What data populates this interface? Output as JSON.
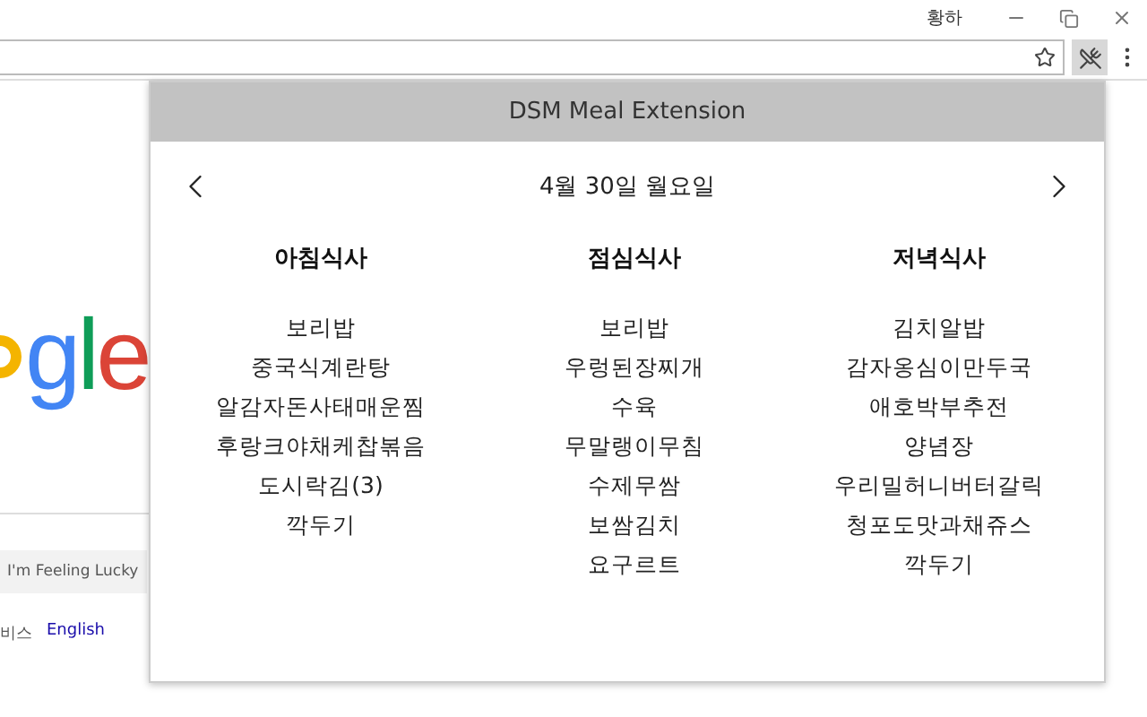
{
  "window": {
    "user": "황하"
  },
  "page": {
    "logo": [
      {
        "text": "g",
        "color": "#4285f4"
      },
      {
        "text": "l",
        "color": "#0f9d58"
      },
      {
        "text": "e",
        "color": "#db4437"
      }
    ],
    "lucky_button": "I'm Feeling Lucky",
    "footer_text": "비스",
    "footer_link": "English"
  },
  "popup": {
    "title": "DSM Meal Extension",
    "date": "4월 30일 월요일",
    "meals": [
      {
        "name": "아침식사",
        "items": [
          "보리밥",
          "중국식계란탕",
          "알감자돈사태매운찜",
          "후랑크야채케찹볶음",
          "도시락김(3)",
          "깍두기"
        ]
      },
      {
        "name": "점심식사",
        "items": [
          "보리밥",
          "우렁된장찌개",
          "수육",
          "무말랭이무침",
          "수제무쌈",
          "보쌈김치",
          "요구르트"
        ]
      },
      {
        "name": "저녁식사",
        "items": [
          "김치알밥",
          "감자옹심이만두국",
          "애호박부추전",
          "양념장",
          "우리밀허니버터갈릭",
          "청포도맛과채쥬스",
          "깍두기"
        ]
      }
    ]
  }
}
